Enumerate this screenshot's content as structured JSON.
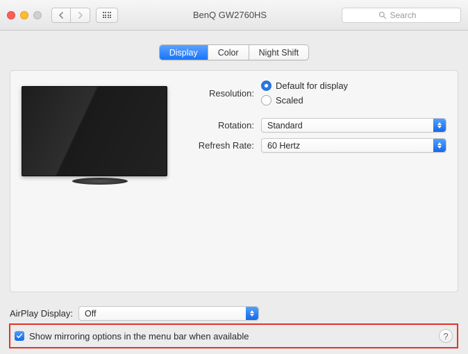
{
  "window": {
    "title": "BenQ GW2760HS"
  },
  "search": {
    "placeholder": "Search"
  },
  "tabs": {
    "display": "Display",
    "color": "Color",
    "nightshift": "Night Shift",
    "active": "display"
  },
  "settings": {
    "resolution_label": "Resolution:",
    "resolution_options": {
      "default": "Default for display",
      "scaled": "Scaled",
      "selected": "default"
    },
    "rotation_label": "Rotation:",
    "rotation_value": "Standard",
    "refresh_label": "Refresh Rate:",
    "refresh_value": "60 Hertz"
  },
  "airplay": {
    "label": "AirPlay Display:",
    "value": "Off"
  },
  "mirroring": {
    "checked": true,
    "label": "Show mirroring options in the menu bar when available"
  },
  "help": {
    "label": "?"
  }
}
